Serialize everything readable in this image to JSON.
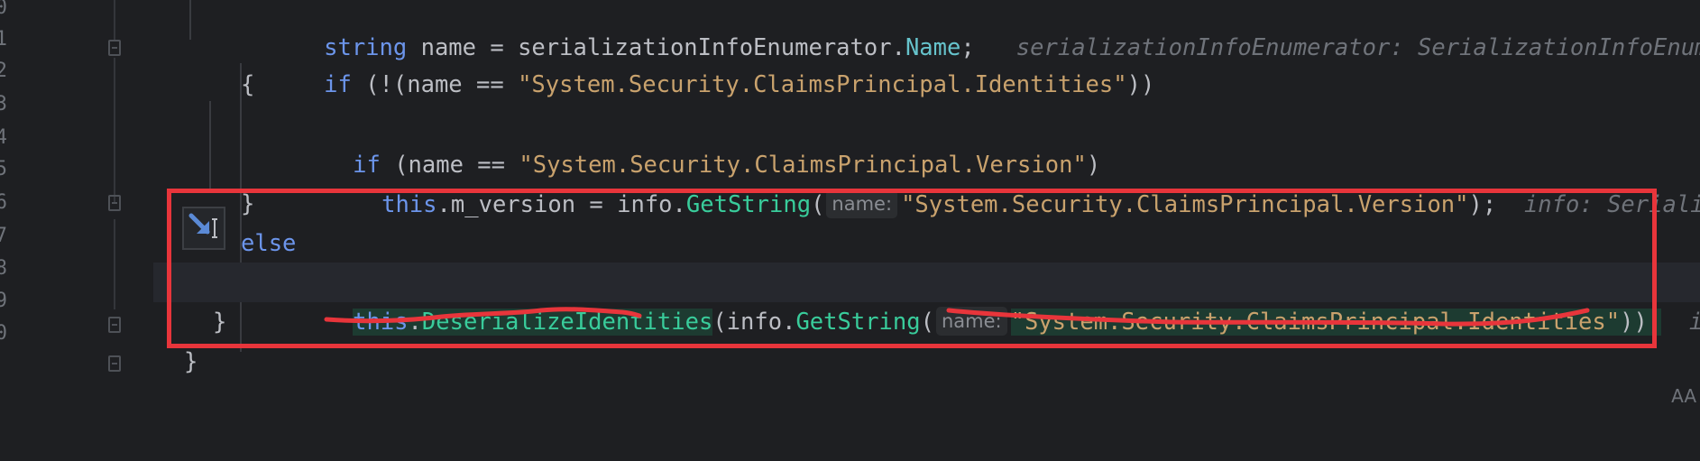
{
  "gutter": {
    "line_numbers": [
      "0",
      "1",
      "2",
      "3",
      "4",
      "5",
      "6",
      "7",
      "8",
      "9",
      "0"
    ]
  },
  "lines": {
    "l0": {
      "t1": "string",
      "t2": " name = serializationInfoEnumerator.",
      "t3": "Name",
      "t4": ";",
      "hint": "serializationInfoEnumerator: SerializationInfoEnumer"
    },
    "l1": {
      "t1": "if",
      "t2": " (!(name == ",
      "t3": "\"System.Security.ClaimsPrincipal.Identities\"",
      "t4": "))"
    },
    "l2": {
      "t1": "{"
    },
    "l3": {
      "t1": "if",
      "t2": " (name == ",
      "t3": "\"System.Security.ClaimsPrincipal.Version\"",
      "t4": ")"
    },
    "l4": {
      "t1": "this",
      "t2": ".m_version = info.",
      "t3": "GetString",
      "t4": "(",
      "param": "name:",
      "t5": "\"System.Security.ClaimsPrincipal.Version\"",
      "t6": ");",
      "hint": "info: Serializa"
    },
    "l5": {
      "t1": "}"
    },
    "l6": {
      "t1": "else"
    },
    "l7": {
      "t1": "this",
      "t2": ".",
      "t3": "DeserializeIdentities",
      "t4": "(info.",
      "t5": "GetString",
      "t6": "(",
      "param": "name:",
      "t7": "\"System.Security.ClaimsPrincipal.Identities\"",
      "t8": "));",
      "hint": "inf"
    },
    "l8": {
      "t1": "}"
    },
    "l9": {
      "t1": "}"
    }
  },
  "colors": {
    "background": "#1e1f22",
    "keyword": "#6c95eb",
    "string": "#c9a26d",
    "method": "#39cc9b",
    "annotation_red": "#e8353b"
  },
  "icons": {
    "action": "arrow-down-right-icon",
    "corner": "AA"
  }
}
